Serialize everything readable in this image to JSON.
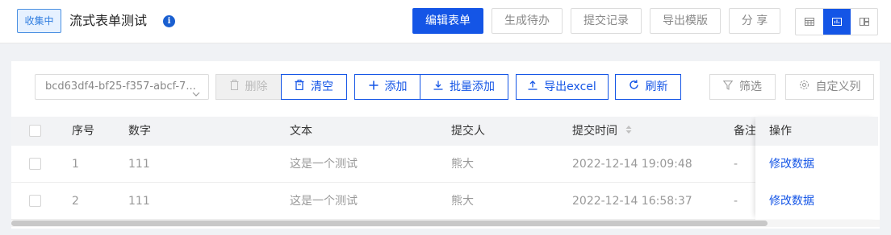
{
  "header": {
    "status_badge": "收集中",
    "title": "流式表单测试",
    "info_icon": "i",
    "buttons": {
      "edit_form": "编辑表单",
      "generate_todo": "生成待办",
      "submit_records": "提交记录",
      "export_template": "导出模版",
      "share": "分 享"
    },
    "views": [
      "table-view-icon",
      "chart-view-icon",
      "card-view-icon"
    ],
    "active_view": "chart-view-icon",
    "accent_color": "#1455e6"
  },
  "toolbar": {
    "select_value": "bcd63df4-bf25-f357-abcf-7...",
    "delete": "删除",
    "clear": "清空",
    "add": "添加",
    "batch_add": "批量添加",
    "export_excel": "导出excel",
    "refresh": "刷新",
    "filter": "筛选",
    "custom_columns": "自定义列"
  },
  "table": {
    "headers": {
      "index": "序号",
      "number": "数字",
      "text": "文本",
      "submitter": "提交人",
      "submit_time": "提交时间",
      "remark": "备注",
      "actions": "操作"
    },
    "rows": [
      {
        "index": "1",
        "number": "111",
        "text": "这是一个测试",
        "submitter": "熊大",
        "submit_time": "2022-12-14 19:09:48",
        "remark": "-",
        "action": "修改数据"
      },
      {
        "index": "2",
        "number": "111",
        "text": "这是一个测试",
        "submitter": "熊大",
        "submit_time": "2022-12-14 16:58:37",
        "remark": "-",
        "action": "修改数据"
      }
    ]
  }
}
